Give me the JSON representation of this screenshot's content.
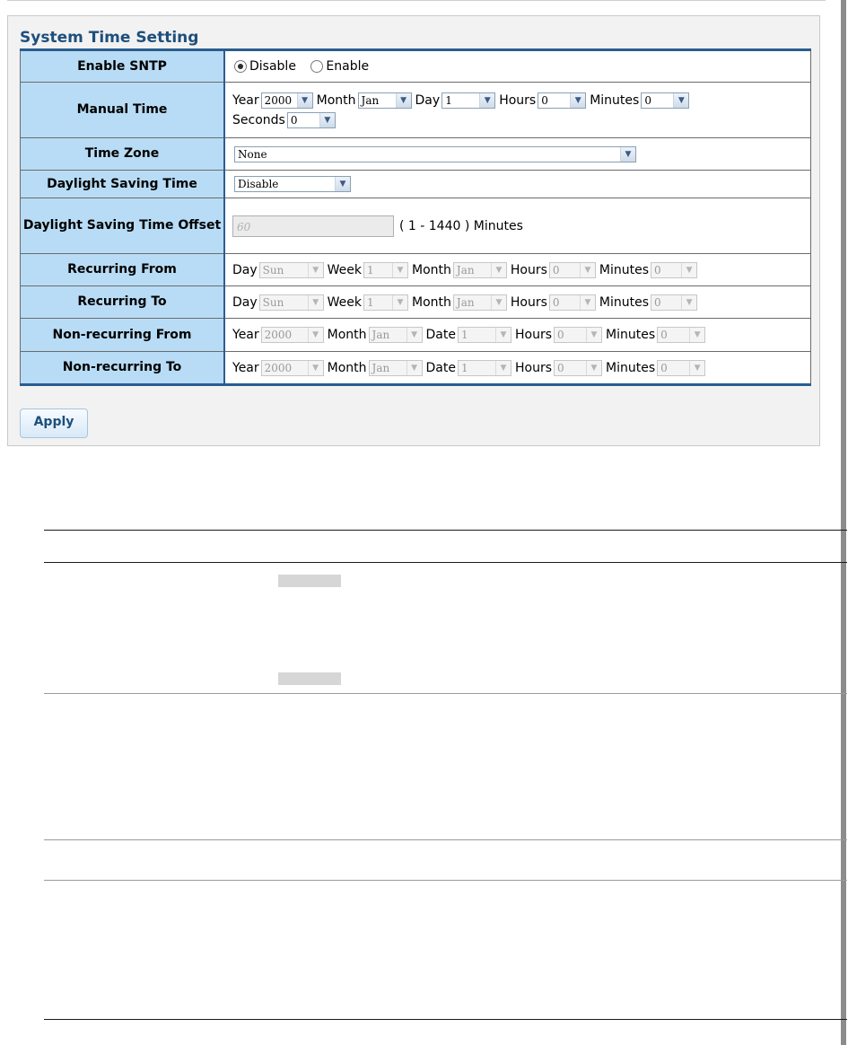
{
  "panel": {
    "title": "System Time Setting",
    "apply_label": "Apply"
  },
  "rows": {
    "enable_sntp": {
      "label": "Enable SNTP",
      "options": [
        "Disable",
        "Enable"
      ],
      "selected": "Disable"
    },
    "manual_time": {
      "label": "Manual Time",
      "year_label": "Year",
      "year": "2000",
      "month_label": "Month",
      "month": "Jan",
      "day_label": "Day",
      "day": "1",
      "hours_label": "Hours",
      "hours": "0",
      "minutes_label": "Minutes",
      "minutes": "0",
      "seconds_label": "Seconds",
      "seconds": "0"
    },
    "time_zone": {
      "label": "Time Zone",
      "value": "None"
    },
    "dst": {
      "label": "Daylight Saving Time",
      "value": "Disable"
    },
    "dst_offset": {
      "label": "Daylight Saving Time Offset",
      "value": "60",
      "range": "( 1 - 1440 ) Minutes"
    },
    "recurring_from": {
      "label": "Recurring From",
      "day_label": "Day",
      "day": "Sun",
      "week_label": "Week",
      "week": "1",
      "month_label": "Month",
      "month": "Jan",
      "hours_label": "Hours",
      "hours": "0",
      "minutes_label": "Minutes",
      "minutes": "0"
    },
    "recurring_to": {
      "label": "Recurring To",
      "day_label": "Day",
      "day": "Sun",
      "week_label": "Week",
      "week": "1",
      "month_label": "Month",
      "month": "Jan",
      "hours_label": "Hours",
      "hours": "0",
      "minutes_label": "Minutes",
      "minutes": "0"
    },
    "nonrecurring_from": {
      "label": "Non-recurring From",
      "year_label": "Year",
      "year": "2000",
      "month_label": "Month",
      "month": "Jan",
      "date_label": "Date",
      "date": "1",
      "hours_label": "Hours",
      "hours": "0",
      "minutes_label": "Minutes",
      "minutes": "0"
    },
    "nonrecurring_to": {
      "label": "Non-recurring To",
      "year_label": "Year",
      "year": "2000",
      "month_label": "Month",
      "month": "Jan",
      "date_label": "Date",
      "date": "1",
      "hours_label": "Hours",
      "hours": "0",
      "minutes_label": "Minutes",
      "minutes": "0"
    }
  }
}
